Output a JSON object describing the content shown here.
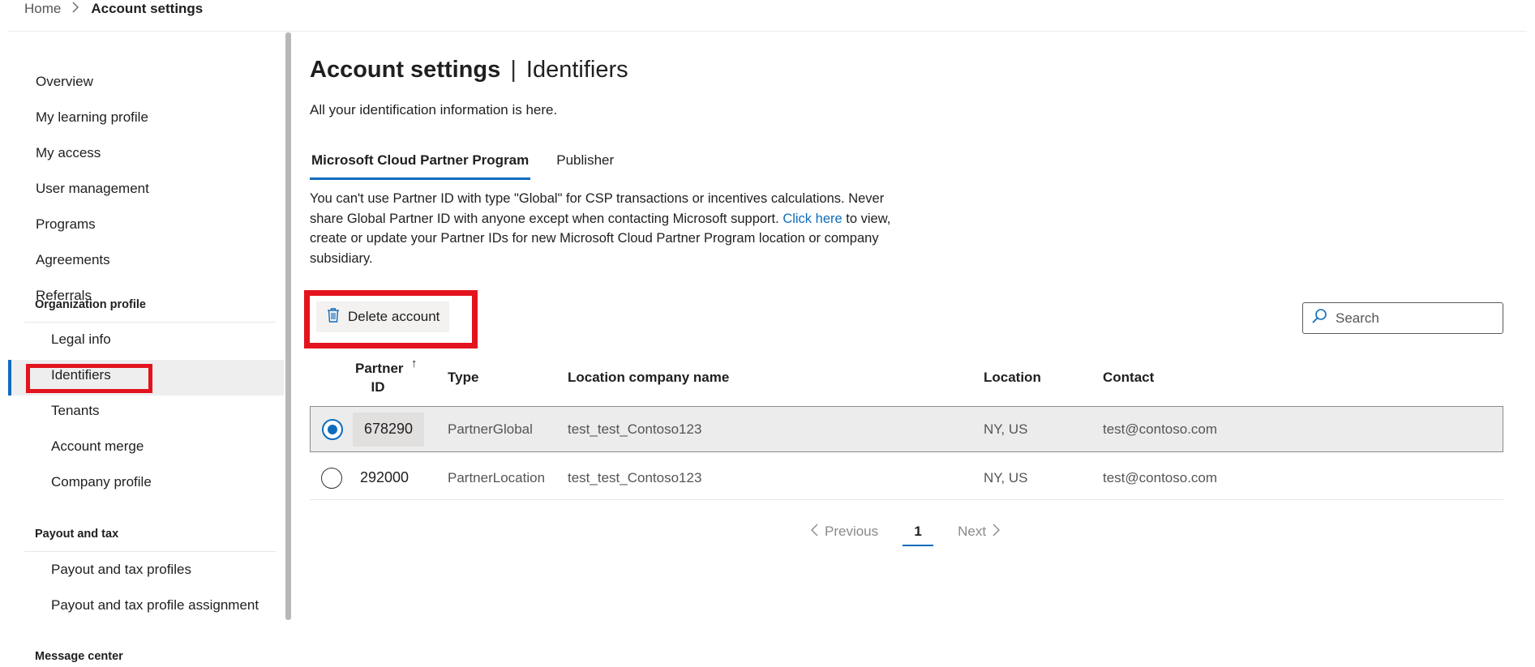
{
  "breadcrumb": {
    "home": "Home",
    "current": "Account settings"
  },
  "sidebar": {
    "items": [
      {
        "label": "Overview"
      },
      {
        "label": "My learning profile"
      },
      {
        "label": "My access"
      },
      {
        "label": "User management"
      },
      {
        "label": "Programs"
      },
      {
        "label": "Agreements"
      },
      {
        "label": "Referrals"
      }
    ],
    "org_profile": {
      "heading": "Organization profile",
      "items": [
        {
          "label": "Legal info"
        },
        {
          "label": "Identifiers"
        },
        {
          "label": "Tenants"
        },
        {
          "label": "Account merge"
        },
        {
          "label": "Company profile"
        }
      ]
    },
    "payout": {
      "heading": "Payout and tax",
      "items": [
        {
          "label": "Payout and tax profiles"
        },
        {
          "label": "Payout and tax profile assignment"
        }
      ]
    },
    "message_center": {
      "heading": "Message center"
    },
    "selected": "Identifiers"
  },
  "main": {
    "title_strong": "Account settings",
    "title_sep": "|",
    "title_rest": "Identifiers",
    "description": "All your identification information is here.",
    "tabs": [
      {
        "label": "Microsoft Cloud Partner Program",
        "active": true
      },
      {
        "label": "Publisher",
        "active": false
      }
    ],
    "info_before": "You can't use Partner ID with type \"Global\" for CSP transactions or incentives calculations. Never share Global Partner ID with anyone except when contacting Microsoft support.",
    "info_link": "Click here",
    "info_after": "to view, create or update your Partner IDs for new Microsoft Cloud Partner Program location or company subsidiary.",
    "delete_label": "Delete account",
    "search_placeholder": "Search"
  },
  "table": {
    "headers": {
      "partner_id": "Partner ID",
      "sort_arrow": "↑",
      "type": "Type",
      "location_company": "Location company name",
      "location": "Location",
      "contact": "Contact"
    },
    "rows": [
      {
        "partner_id": "678290",
        "type": "PartnerGlobal",
        "location_company": "test_test_Contoso123",
        "location": "NY, US",
        "contact": "test@contoso.com",
        "selected": true
      },
      {
        "partner_id": "292000",
        "type": "PartnerLocation",
        "location_company": "test_test_Contoso123",
        "location": "NY, US",
        "contact": "test@contoso.com",
        "selected": false
      }
    ]
  },
  "pagination": {
    "previous": "Previous",
    "current_page": "1",
    "next": "Next"
  },
  "colors": {
    "accent": "#0f6cbd",
    "highlight": "#e3141e"
  },
  "icons": {
    "delete": "trash-icon",
    "search": "search-icon",
    "prev": "chevron-left-icon",
    "next": "chevron-right-icon",
    "breadcrumb_sep": "chevron-right-icon"
  }
}
